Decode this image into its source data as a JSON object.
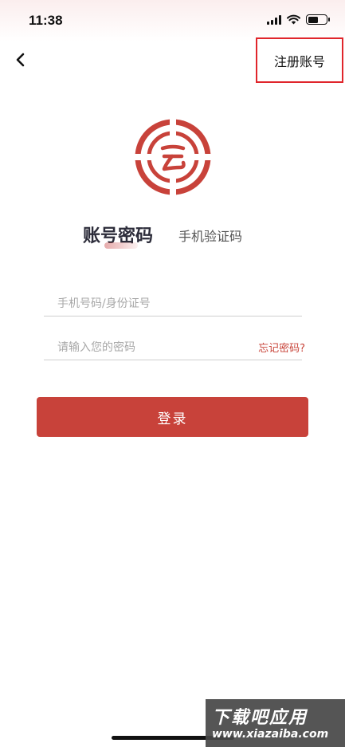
{
  "status_bar": {
    "time": "11:38"
  },
  "header": {
    "register_label": "注册账号"
  },
  "tabs": {
    "active": "账号密码",
    "inactive": "手机验证码"
  },
  "form": {
    "phone_placeholder": "手机号码/身份证号",
    "password_placeholder": "请输入您的密码",
    "forgot_label": "忘记密码?"
  },
  "login_button_label": "登录",
  "watermark": {
    "line1": "下载吧应用",
    "line2": "www.xiazaiba.com"
  },
  "colors": {
    "accent": "#c8423a",
    "highlight_border": "#e0252b"
  }
}
